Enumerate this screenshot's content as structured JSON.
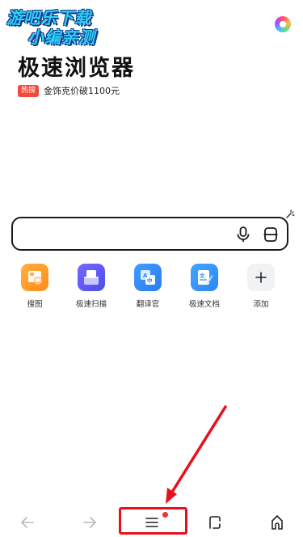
{
  "watermark": {
    "line1": "游吧乐下载",
    "line2": "小编亲测"
  },
  "header": {
    "app_title": "极速浏览器",
    "hot_badge": "热搜",
    "hot_text": "金饰克价破1100元"
  },
  "search": {
    "value": "",
    "placeholder": ""
  },
  "shortcuts": [
    {
      "label": "搜图",
      "icon": "image-search-icon",
      "color": "#ff9a2a"
    },
    {
      "label": "极速扫描",
      "icon": "scanner-icon",
      "color": "#5b56f0"
    },
    {
      "label": "翻译官",
      "icon": "translate-icon",
      "color": "#3a94fb"
    },
    {
      "label": "极速文档",
      "icon": "document-icon",
      "color": "#3996fa"
    },
    {
      "label": "添加",
      "icon": "plus-icon",
      "color": "#f1f2f4"
    }
  ],
  "bottom_nav": {
    "items": [
      "back-arrow-icon",
      "forward-arrow-icon",
      "menu-icon",
      "tabs-icon",
      "home-icon"
    ]
  },
  "colors": {
    "annotation_red": "#e8101c",
    "hot_badge": "#f24a3a",
    "watermark_cyan": "#2fd0f5"
  }
}
